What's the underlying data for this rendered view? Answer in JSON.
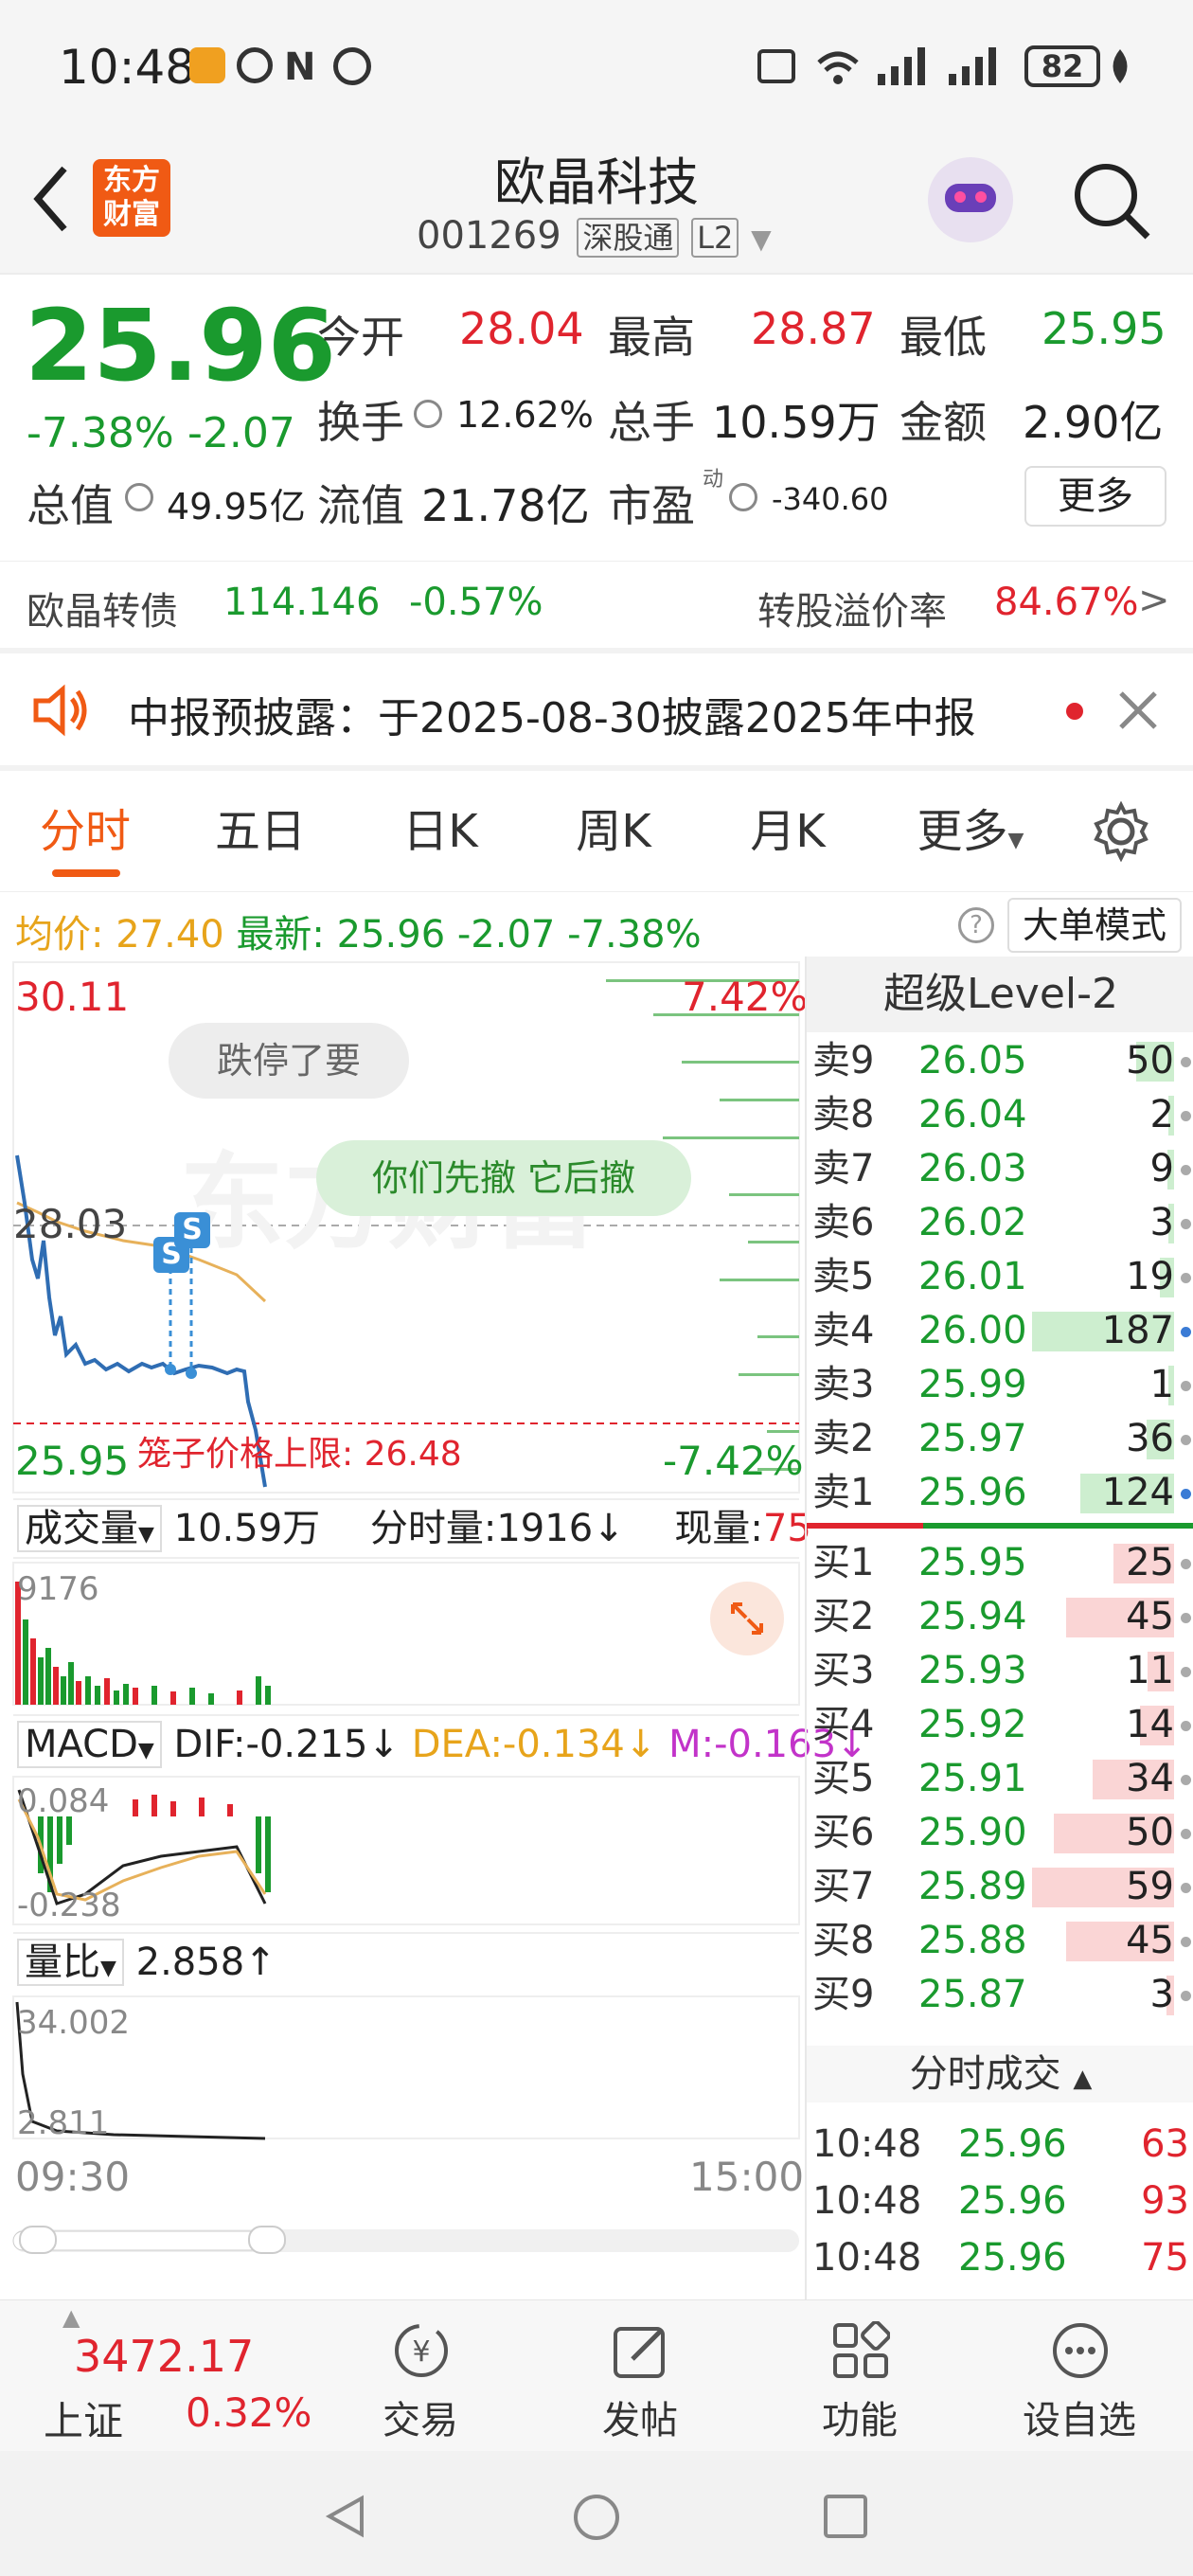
{
  "status": {
    "time": "10:48",
    "battery": "82"
  },
  "header": {
    "logo_line1": "东方",
    "logo_line2": "财富",
    "title": "欧晶科技",
    "code": "001269",
    "tag1": "深股通",
    "tag2": "L2"
  },
  "quote": {
    "price": "25.96",
    "change_pct": "-7.38%",
    "change": "-2.07",
    "open_label": "今开",
    "open": "28.04",
    "high_label": "最高",
    "high": "28.87",
    "low_label": "最低",
    "low": "25.95",
    "turnover_label": "换手",
    "turnover": "12.62%",
    "volume_label": "总手",
    "volume": "10.59万",
    "amount_label": "金额",
    "amount": "2.90亿",
    "mktcap_label": "总值",
    "mktcap": "49.95亿",
    "float_label": "流值",
    "float": "21.78亿",
    "pe_label": "市盈",
    "pe_sup": "动",
    "pe": "-340.60",
    "more": "更多"
  },
  "bond": {
    "name": "欧晶转债",
    "price": "114.146",
    "chg": "-0.57%",
    "premium_label": "转股溢价率",
    "premium": "84.67%",
    "arrow": ">"
  },
  "notice": {
    "text": "中报预披露：于2025-08-30披露2025年中报"
  },
  "tabs": [
    "分时",
    "五日",
    "日K",
    "周K",
    "月K",
    "更多"
  ],
  "avgbar": {
    "avg_label": "均价:",
    "avg": "27.40",
    "last_label": "最新:",
    "last": "25.96",
    "chg": "-2.07",
    "pct": "-7.38%",
    "help": "?",
    "mode": "大单模式"
  },
  "chart": {
    "top_price": "30.11",
    "top_pct": "7.42%",
    "mid_price": "28.03",
    "bot_price": "25.95",
    "bot_pct": "-7.42%",
    "comment1": "跌停了要",
    "comment2": "你们先撤 它后撤",
    "watermark": "东方财富",
    "cage_label": "笼子价格上限:",
    "cage_value": "26.48",
    "marker": "S",
    "vol_label": "成交量",
    "vol_total": "10.59万",
    "vol_tick_label": "分时量:1916↓",
    "vol_now_label": "现量:",
    "vol_now": "75",
    "vol_max": "9176",
    "macd_label": "MACD",
    "dif": "DIF:-0.215↓",
    "dea": "DEA:-0.134↓",
    "m": "M:-0.163↓",
    "macd_top": "0.084",
    "macd_bot": "-0.238",
    "ratio_label": "量比",
    "ratio": "2.858↑",
    "ratio_top": "34.002",
    "ratio_bot": "2.811",
    "time_start": "09:30",
    "time_end": "15:00"
  },
  "orderbook": {
    "title": "超级Level-2",
    "asks": [
      {
        "label": "卖9",
        "price": "26.05",
        "vol": "50"
      },
      {
        "label": "卖8",
        "price": "26.04",
        "vol": "2"
      },
      {
        "label": "卖7",
        "price": "26.03",
        "vol": "9"
      },
      {
        "label": "卖6",
        "price": "26.02",
        "vol": "3"
      },
      {
        "label": "卖5",
        "price": "26.01",
        "vol": "19"
      },
      {
        "label": "卖4",
        "price": "26.00",
        "vol": "187"
      },
      {
        "label": "卖3",
        "price": "25.99",
        "vol": "1"
      },
      {
        "label": "卖2",
        "price": "25.97",
        "vol": "36"
      },
      {
        "label": "卖1",
        "price": "25.96",
        "vol": "124"
      }
    ],
    "bids": [
      {
        "label": "买1",
        "price": "25.95",
        "vol": "25"
      },
      {
        "label": "买2",
        "price": "25.94",
        "vol": "45"
      },
      {
        "label": "买3",
        "price": "25.93",
        "vol": "11"
      },
      {
        "label": "买4",
        "price": "25.92",
        "vol": "14"
      },
      {
        "label": "买5",
        "price": "25.91",
        "vol": "34"
      },
      {
        "label": "买6",
        "price": "25.90",
        "vol": "50"
      },
      {
        "label": "买7",
        "price": "25.89",
        "vol": "59"
      },
      {
        "label": "买8",
        "price": "25.88",
        "vol": "45"
      },
      {
        "label": "买9",
        "price": "25.87",
        "vol": "3"
      }
    ],
    "trades_title": "分时成交",
    "trades": [
      {
        "time": "10:48",
        "price": "25.96",
        "vol": "63"
      },
      {
        "time": "10:48",
        "price": "25.96",
        "vol": "93"
      },
      {
        "time": "10:48",
        "price": "25.96",
        "vol": "75"
      }
    ]
  },
  "bottomnav": {
    "index_value": "3472.17",
    "index_name": "上证",
    "index_pct": "0.32%",
    "trade": "交易",
    "post": "发帖",
    "func": "功能",
    "watch": "设自选"
  },
  "colors": {
    "up": "#e0242e",
    "down": "#1a9a2e",
    "accent": "#f05a14",
    "avg_line": "#e7b15a",
    "price_line": "#2f6db3"
  }
}
